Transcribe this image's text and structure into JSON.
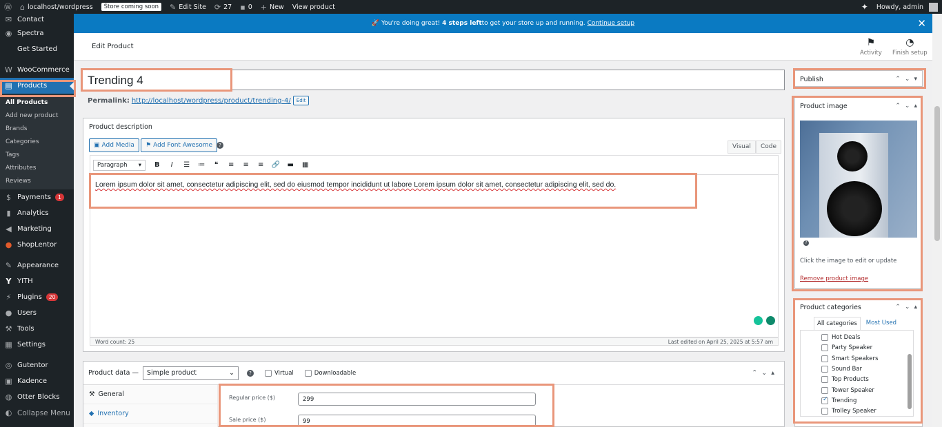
{
  "adminbar": {
    "site": "localhost/wordpress",
    "store_badge": "Store coming soon",
    "edit_site": "Edit Site",
    "updates": "27",
    "comments": "0",
    "new": "New",
    "view_product": "View product",
    "howdy": "Howdy, admin"
  },
  "sidebar": {
    "items": [
      {
        "label": "Contact",
        "icon": "mail-icon"
      },
      {
        "label": "Spectra",
        "icon": "spectra-icon"
      },
      {
        "label": "Get Started",
        "icon": ""
      },
      {
        "label": "WooCommerce",
        "icon": "woo-icon"
      },
      {
        "label": "Products",
        "icon": "archive-icon"
      }
    ],
    "submenu": [
      "All Products",
      "Add new product",
      "Brands",
      "Categories",
      "Tags",
      "Attributes",
      "Reviews"
    ],
    "items2": [
      {
        "label": "Payments",
        "icon": "payment-icon",
        "count": "1"
      },
      {
        "label": "Analytics",
        "icon": "chart-icon"
      },
      {
        "label": "Marketing",
        "icon": "megaphone-icon"
      },
      {
        "label": "ShopLentor",
        "icon": "shoplentor-icon"
      },
      {
        "label": "Appearance",
        "icon": "brush-icon"
      },
      {
        "label": "YITH",
        "icon": "yith-icon"
      },
      {
        "label": "Plugins",
        "icon": "plug-icon",
        "count": "20"
      },
      {
        "label": "Users",
        "icon": "user-icon"
      },
      {
        "label": "Tools",
        "icon": "wrench-icon"
      },
      {
        "label": "Settings",
        "icon": "settings-icon"
      },
      {
        "label": "Gutentor",
        "icon": "gutentor-icon"
      },
      {
        "label": "Kadence",
        "icon": "kadence-icon"
      },
      {
        "label": "Otter Blocks",
        "icon": "otter-icon"
      },
      {
        "label": "Collapse Menu",
        "icon": "collapse-icon"
      }
    ]
  },
  "notice": {
    "prefix": "🚀 You're doing great! ",
    "bold": "4 steps left",
    "suffix": " to get your store up and running.",
    "link": "Continue setup"
  },
  "header": {
    "title": "Edit Product",
    "activity": "Activity",
    "finish_setup": "Finish setup"
  },
  "product": {
    "title": "Trending 4",
    "permalink_label": "Permalink:",
    "permalink_url": "http://localhost/wordpress/product/trending-4/",
    "permalink_edit": "Edit"
  },
  "description": {
    "heading": "Product description",
    "add_media": "Add Media",
    "add_font_awesome": "Add Font Awesome",
    "tab_visual": "Visual",
    "tab_code": "Code",
    "format": "Paragraph",
    "content": "Lorem ipsum dolor sit amet, consectetur adipiscing elit, sed do eiusmod tempor incididunt ut labore Lorem ipsum dolor sit amet, consectetur adipiscing elit, sed do.",
    "word_count": "Word count: 25",
    "last_edited": "Last edited on April 25, 2025 at 5:57 am"
  },
  "product_data": {
    "label": "Product data —",
    "type": "Simple product",
    "virtual": "Virtual",
    "downloadable": "Downloadable",
    "tabs": [
      "General",
      "Inventory"
    ],
    "regular_price_label": "Regular price ($)",
    "regular_price": "299",
    "sale_price_label": "Sale price ($)",
    "sale_price": "99"
  },
  "publish": {
    "heading": "Publish"
  },
  "product_image": {
    "heading": "Product image",
    "hint": "Click the image to edit or update",
    "remove": "Remove product image"
  },
  "categories": {
    "heading": "Product categories",
    "tab_all": "All categories",
    "tab_most_used": "Most Used",
    "items": [
      {
        "label": "Hot Deals",
        "checked": false
      },
      {
        "label": "Party Speaker",
        "checked": false
      },
      {
        "label": "Smart Speakers",
        "checked": false
      },
      {
        "label": "Sound Bar",
        "checked": false
      },
      {
        "label": "Top Products",
        "checked": false
      },
      {
        "label": "Tower Speaker",
        "checked": false
      },
      {
        "label": "Trending",
        "checked": true
      },
      {
        "label": "Trolley Speaker",
        "checked": false
      }
    ]
  },
  "colors": {
    "accent": "#2271b1",
    "notice": "#0a7ac2",
    "highlight": "#e9967a",
    "sidebar": "#1d2327"
  }
}
